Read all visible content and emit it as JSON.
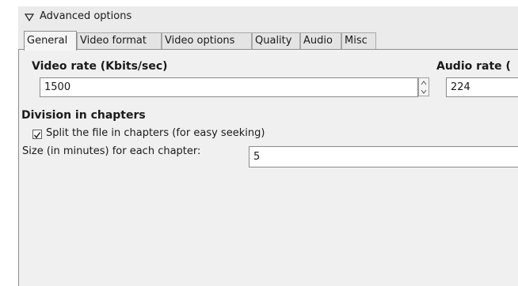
{
  "header": {
    "title": "Advanced options",
    "expander_icon": "triangle-down-outline"
  },
  "tabs": [
    {
      "label": "General",
      "active": true
    },
    {
      "label": "Video format",
      "active": false
    },
    {
      "label": "Video options",
      "active": false
    },
    {
      "label": "Quality",
      "active": false
    },
    {
      "label": "Audio",
      "active": false
    },
    {
      "label": "Misc",
      "active": false
    }
  ],
  "general": {
    "video_rate": {
      "label": "Video rate (Kbits/sec)",
      "value": "1500"
    },
    "audio_rate": {
      "label": "Audio rate (",
      "value": "224"
    },
    "division": {
      "heading": "Division in chapters",
      "split_checkbox": {
        "label": "Split the file in chapters (for easy seeking)",
        "checked": true
      },
      "chapter_size": {
        "label": "Size (in minutes) for each chapter:",
        "value": "5"
      }
    }
  }
}
